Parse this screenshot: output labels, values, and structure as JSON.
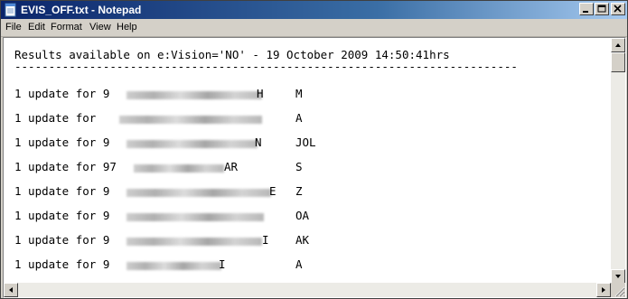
{
  "window": {
    "title": "EVIS_OFF.txt - Notepad",
    "title_bar_color": "#0a246a"
  },
  "menu": {
    "items": [
      "File",
      "Edit",
      "Format",
      "View",
      "Help"
    ]
  },
  "document": {
    "header": "Results available on e:Vision='NO' - 19 October 2009 14:50:41hrs",
    "separator": "--------------------------------------------------------------------------",
    "rows": [
      {
        "prefix": "1 update for 9",
        "suffix": "H",
        "code": "M"
      },
      {
        "prefix": "1 update for ",
        "suffix": "",
        "code": "A"
      },
      {
        "prefix": "1 update for 9",
        "suffix": "N",
        "code": "JOL"
      },
      {
        "prefix": "1 update for 97",
        "suffix": "AR",
        "code": "S"
      },
      {
        "prefix": "1 update for 9",
        "suffix": "E",
        "code": "Z"
      },
      {
        "prefix": "1 update for 9",
        "suffix": "",
        "code": "OA"
      },
      {
        "prefix": "1 update for 9",
        "suffix": "I",
        "code": "AK"
      },
      {
        "prefix": "1 update for 9",
        "suffix": "I",
        "code": "A"
      }
    ]
  },
  "icons": {
    "app": "notepad-icon",
    "minimize": "minimize-icon",
    "maximize": "maximize-icon",
    "close": "close-icon"
  }
}
